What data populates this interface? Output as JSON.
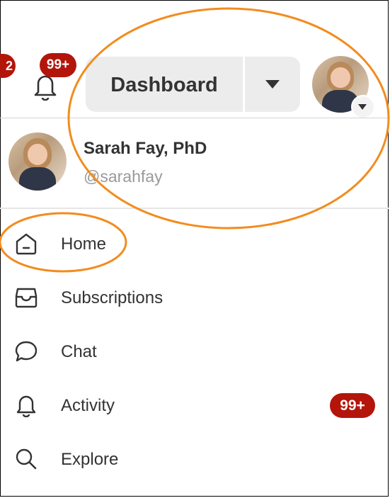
{
  "header": {
    "partial_badge": "2",
    "notifications_badge": "99+",
    "dashboard_label": "Dashboard"
  },
  "user": {
    "name": "Sarah Fay, PhD",
    "handle": "@sarahfay"
  },
  "menu": {
    "items": [
      {
        "label": "Home",
        "icon": "home-icon"
      },
      {
        "label": "Subscriptions",
        "icon": "inbox-icon"
      },
      {
        "label": "Chat",
        "icon": "chat-icon"
      },
      {
        "label": "Activity",
        "icon": "bell-icon",
        "badge": "99+"
      },
      {
        "label": "Explore",
        "icon": "search-icon"
      }
    ]
  },
  "colors": {
    "badge": "#b3150b",
    "annotation": "#f28c1e",
    "button_bg": "#ececec"
  }
}
